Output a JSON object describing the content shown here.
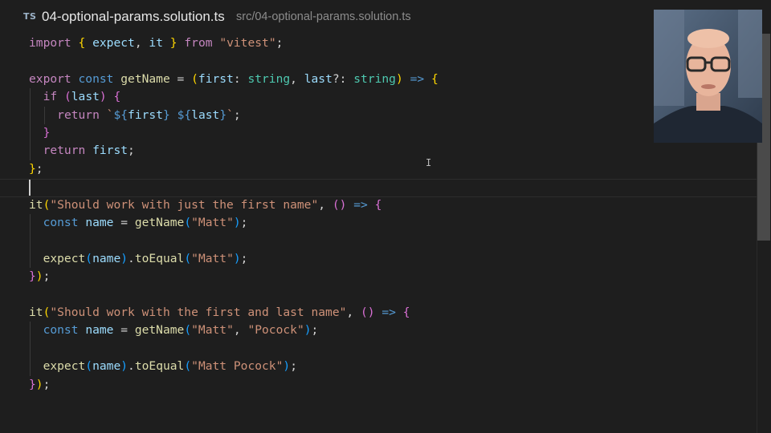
{
  "tab": {
    "lang_badge": "TS",
    "filename": "04-optional-params.solution.ts",
    "path": "src/04-optional-params.solution.ts"
  },
  "colors": {
    "background": "#1e1e1e",
    "keyword": "#c586c0",
    "storage": "#569cd6",
    "variable": "#9cdcfe",
    "function": "#dcdcaa",
    "string": "#ce9178",
    "type": "#4ec9b0",
    "bracket_1": "#ffd700",
    "bracket_2": "#da70d6",
    "bracket_3": "#179fff"
  },
  "code": [
    [
      [
        "kw",
        "import"
      ],
      [
        "plain",
        " "
      ],
      [
        "p1",
        "{"
      ],
      [
        "plain",
        " "
      ],
      [
        "var",
        "expect"
      ],
      [
        "plain",
        ", "
      ],
      [
        "var",
        "it"
      ],
      [
        "plain",
        " "
      ],
      [
        "p1",
        "}"
      ],
      [
        "plain",
        " "
      ],
      [
        "kw",
        "from"
      ],
      [
        "plain",
        " "
      ],
      [
        "str",
        "\"vitest\""
      ],
      [
        "plain",
        ";"
      ]
    ],
    [],
    [
      [
        "kw",
        "export"
      ],
      [
        "plain",
        " "
      ],
      [
        "kw2",
        "const"
      ],
      [
        "plain",
        " "
      ],
      [
        "fn",
        "getName"
      ],
      [
        "plain",
        " = "
      ],
      [
        "p1",
        "("
      ],
      [
        "var",
        "first"
      ],
      [
        "plain",
        ": "
      ],
      [
        "type",
        "string"
      ],
      [
        "plain",
        ", "
      ],
      [
        "var",
        "last"
      ],
      [
        "plain",
        "?: "
      ],
      [
        "type",
        "string"
      ],
      [
        "p1",
        ")"
      ],
      [
        "plain",
        " "
      ],
      [
        "kw2",
        "=>"
      ],
      [
        "plain",
        " "
      ],
      [
        "p1",
        "{"
      ]
    ],
    [
      [
        "plain",
        "  "
      ],
      [
        "kw",
        "if"
      ],
      [
        "plain",
        " "
      ],
      [
        "p2",
        "("
      ],
      [
        "var",
        "last"
      ],
      [
        "p2",
        ")"
      ],
      [
        "plain",
        " "
      ],
      [
        "p2",
        "{"
      ]
    ],
    [
      [
        "plain",
        "    "
      ],
      [
        "kw",
        "return"
      ],
      [
        "plain",
        " "
      ],
      [
        "str",
        "`"
      ],
      [
        "kw2",
        "${"
      ],
      [
        "var",
        "first"
      ],
      [
        "kw2",
        "}"
      ],
      [
        "str",
        " "
      ],
      [
        "kw2",
        "${"
      ],
      [
        "var",
        "last"
      ],
      [
        "kw2",
        "}"
      ],
      [
        "str",
        "`"
      ],
      [
        "plain",
        ";"
      ]
    ],
    [
      [
        "plain",
        "  "
      ],
      [
        "p2",
        "}"
      ]
    ],
    [
      [
        "plain",
        "  "
      ],
      [
        "kw",
        "return"
      ],
      [
        "plain",
        " "
      ],
      [
        "var",
        "first"
      ],
      [
        "plain",
        ";"
      ]
    ],
    [
      [
        "p1",
        "}"
      ],
      [
        "plain",
        ";"
      ]
    ],
    [],
    [
      [
        "fn",
        "it"
      ],
      [
        "p1",
        "("
      ],
      [
        "str",
        "\"Should work with just the first name\""
      ],
      [
        "plain",
        ", "
      ],
      [
        "p2",
        "()"
      ],
      [
        "plain",
        " "
      ],
      [
        "kw2",
        "=>"
      ],
      [
        "plain",
        " "
      ],
      [
        "p2",
        "{"
      ]
    ],
    [
      [
        "plain",
        "  "
      ],
      [
        "kw2",
        "const"
      ],
      [
        "plain",
        " "
      ],
      [
        "var",
        "name"
      ],
      [
        "plain",
        " = "
      ],
      [
        "fn",
        "getName"
      ],
      [
        "p3",
        "("
      ],
      [
        "str",
        "\"Matt\""
      ],
      [
        "p3",
        ")"
      ],
      [
        "plain",
        ";"
      ]
    ],
    [],
    [
      [
        "plain",
        "  "
      ],
      [
        "fn",
        "expect"
      ],
      [
        "p3",
        "("
      ],
      [
        "var",
        "name"
      ],
      [
        "p3",
        ")"
      ],
      [
        "plain",
        "."
      ],
      [
        "fn",
        "toEqual"
      ],
      [
        "p3",
        "("
      ],
      [
        "str",
        "\"Matt\""
      ],
      [
        "p3",
        ")"
      ],
      [
        "plain",
        ";"
      ]
    ],
    [
      [
        "p2",
        "}"
      ],
      [
        "p1",
        ")"
      ],
      [
        "plain",
        ";"
      ]
    ],
    [],
    [
      [
        "fn",
        "it"
      ],
      [
        "p1",
        "("
      ],
      [
        "str",
        "\"Should work with the first and last name\""
      ],
      [
        "plain",
        ", "
      ],
      [
        "p2",
        "()"
      ],
      [
        "plain",
        " "
      ],
      [
        "kw2",
        "=>"
      ],
      [
        "plain",
        " "
      ],
      [
        "p2",
        "{"
      ]
    ],
    [
      [
        "plain",
        "  "
      ],
      [
        "kw2",
        "const"
      ],
      [
        "plain",
        " "
      ],
      [
        "var",
        "name"
      ],
      [
        "plain",
        " = "
      ],
      [
        "fn",
        "getName"
      ],
      [
        "p3",
        "("
      ],
      [
        "str",
        "\"Matt\""
      ],
      [
        "plain",
        ", "
      ],
      [
        "str",
        "\"Pocock\""
      ],
      [
        "p3",
        ")"
      ],
      [
        "plain",
        ";"
      ]
    ],
    [],
    [
      [
        "plain",
        "  "
      ],
      [
        "fn",
        "expect"
      ],
      [
        "p3",
        "("
      ],
      [
        "var",
        "name"
      ],
      [
        "p3",
        ")"
      ],
      [
        "plain",
        "."
      ],
      [
        "fn",
        "toEqual"
      ],
      [
        "p3",
        "("
      ],
      [
        "str",
        "\"Matt Pocock\""
      ],
      [
        "p3",
        ")"
      ],
      [
        "plain",
        ";"
      ]
    ],
    [
      [
        "p2",
        "}"
      ],
      [
        "p1",
        ")"
      ],
      [
        "plain",
        ";"
      ]
    ]
  ]
}
